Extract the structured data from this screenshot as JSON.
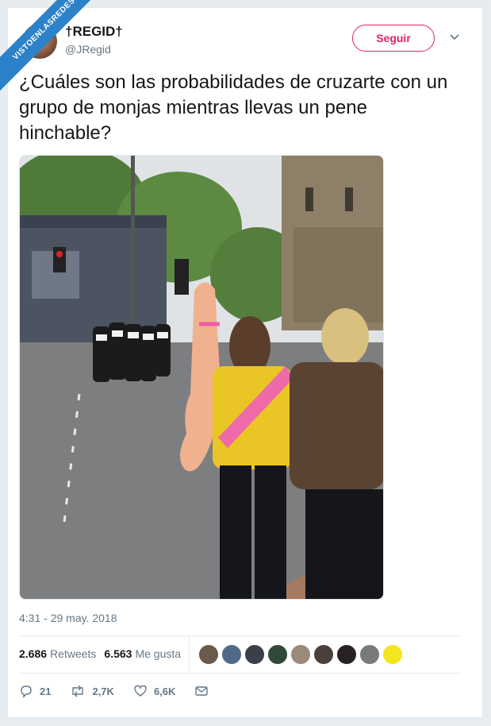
{
  "watermark": {
    "text": "VISTOENLASREDES"
  },
  "header": {
    "display_name": "†REGID†",
    "handle": "@JRegid",
    "follow_label": "Seguir"
  },
  "tweet": {
    "text": "¿Cuáles son las probabilidades de cruzarte con un grupo de monjas mientras llevas un pene hinchable?",
    "timestamp": "4:31 - 29 may. 2018"
  },
  "stats": {
    "retweets_count": "2.686",
    "retweets_label": "Retweets",
    "likes_count": "6.563",
    "likes_label": "Me gusta",
    "liker_avatar_colors": [
      "#6b5a4a",
      "#4f6b88",
      "#3a3f4a",
      "#2f4a36",
      "#9a8a7a",
      "#4a3f3a",
      "#2a2222",
      "#7a7a7a",
      "#f5e51e"
    ]
  },
  "actions": {
    "replies": "21",
    "retweets": "2,7K",
    "likes": "6,6K"
  },
  "colors": {
    "accent": "#e0245e",
    "text": "#14171a",
    "muted": "#657786",
    "watermark": "#2c82c9"
  }
}
